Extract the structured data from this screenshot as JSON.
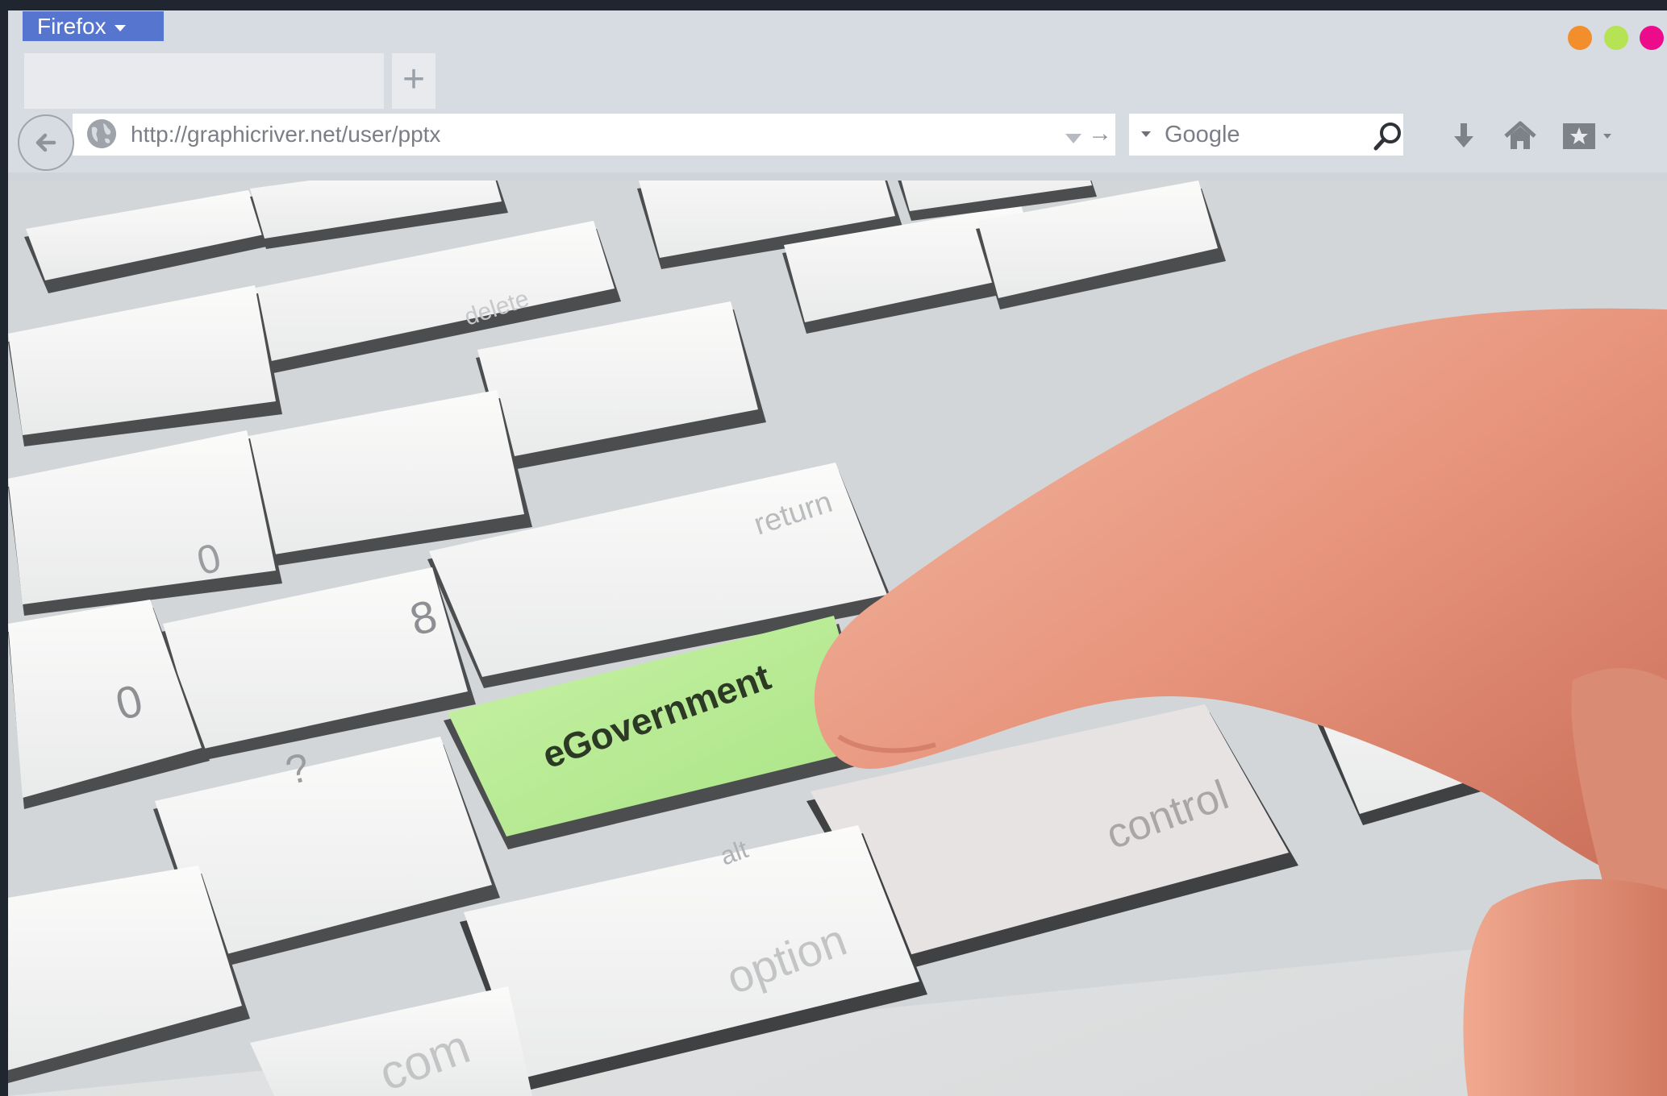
{
  "browser": {
    "menu_label": "Firefox",
    "new_tab_symbol": "+"
  },
  "urlbar": {
    "url": "http://graphicriver.net/user/pptx",
    "go_symbol": "→"
  },
  "search": {
    "placeholder": "Google"
  },
  "toolbar_icons": [
    "download-icon",
    "home-icon",
    "bookmarks-icon"
  ],
  "window_controls": {
    "minimize_color": "#f28e2b",
    "maximize_color": "#b6e354",
    "close_color": "#ec0b8a"
  },
  "content": {
    "highlighted_key_label": "eGovernment",
    "key_labels": {
      "return": "return",
      "control": "control",
      "option": "option",
      "alt": "alt",
      "delete": "delete",
      "command": "com"
    },
    "highlight_color": "#b6ec8e"
  }
}
